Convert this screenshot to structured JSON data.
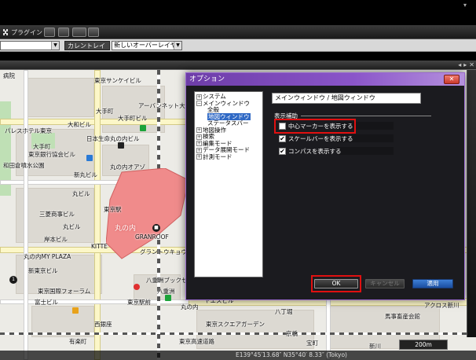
{
  "toolbar": {
    "plugin_label": "プラグイン",
    "current_layer_label": "カレントレイヤー",
    "new_overlay_layer": "新しいオーバーレイヤー"
  },
  "map": {
    "labels": [
      "病院",
      "東京サンケイビル",
      "アーバンネット大手町ビル",
      "大手町",
      "大手町ビル",
      "パレスホテル東京",
      "大和ビル",
      "日本生命丸の内ビル",
      "大手町",
      "東京銀行協会ビル",
      "丸の内オアゾ",
      "新丸ビル",
      "和田倉噴水公園",
      "丸ビル",
      "東京駅",
      "丸の内",
      "三菱商事ビル",
      "丸ビル",
      "GRANROOF",
      "岸本ビル",
      "KITTE",
      "丸の内MY PLAZA",
      "グラントウキョウサウスタワー",
      "新東京ビル",
      "東京国際フォーラム",
      "八重洲ブックセンター",
      "富士ビル",
      "八重洲",
      "東京駅前",
      "ヤエスビル",
      "西銀座",
      "丸の内",
      "有楽町",
      "東京高速道路",
      "東京スクエアガーデン",
      "八丁堀",
      "京橋",
      "宝町",
      "新川",
      "アクロス新川",
      "馬事畜産会館"
    ],
    "status": {
      "coords": "E139°45′13.68″ N35°40′ 8.33″ (Tokyo)",
      "scale": "200m"
    }
  },
  "dialog": {
    "title": "オプション",
    "close": "✕",
    "tree": [
      {
        "label": "システム",
        "toggle": "+",
        "children": []
      },
      {
        "label": "メインウィンドウ",
        "toggle": "−",
        "children": [
          "全般",
          "地図ウィンドウ",
          "ステータスバー"
        ]
      },
      {
        "label": "地図操作",
        "toggle": "+",
        "children": []
      },
      {
        "label": "検索",
        "toggle": "+",
        "children": []
      },
      {
        "label": "編集モード",
        "toggle": "+",
        "children": []
      },
      {
        "label": "データ展開モード",
        "toggle": "+",
        "children": []
      },
      {
        "label": "計測モード",
        "toggle": "+",
        "children": []
      }
    ],
    "selected_node": "地図ウィンドウ",
    "panel_title": "メインウィンドウ / 地図ウィンドウ",
    "section_label": "表示補助",
    "options": [
      {
        "label": "中心マーカーを表示する",
        "checked": false
      },
      {
        "label": "スケールバーを表示する",
        "checked": true
      },
      {
        "label": "コンパスを表示する",
        "checked": true
      }
    ],
    "ok": "OK",
    "cancel": "キャンセル",
    "apply": "適用"
  },
  "colors": {
    "title_gradient_start": "#6d3da8",
    "title_gradient_end": "#b591dd",
    "highlight": "#e01010",
    "apply_button": "#1a4ea0",
    "station_fill": "#f08b8b"
  }
}
